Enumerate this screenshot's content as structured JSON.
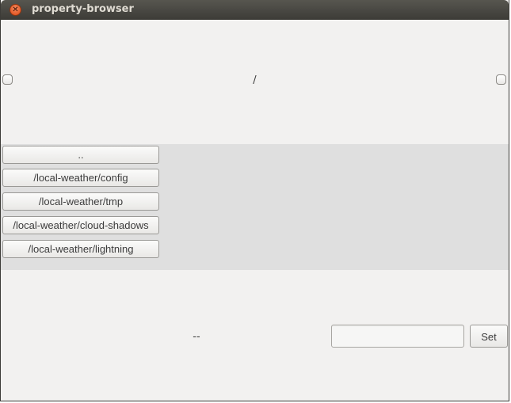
{
  "window": {
    "title": "property-browser",
    "close_glyph": "✕"
  },
  "path": {
    "current": "/"
  },
  "nodes": [
    {
      "label": ".."
    },
    {
      "label": "/local-weather/config"
    },
    {
      "label": "/local-weather/tmp"
    },
    {
      "label": "/local-weather/cloud-shadows"
    },
    {
      "label": "/local-weather/lightning"
    }
  ],
  "value_editor": {
    "current_value": "--",
    "input_value": "",
    "set_label": "Set"
  },
  "colors": {
    "titlebar": "#3c3b37",
    "window_bg": "#f2f1f0",
    "list_bg": "#dfdfdf",
    "close_button": "#df4a16"
  }
}
